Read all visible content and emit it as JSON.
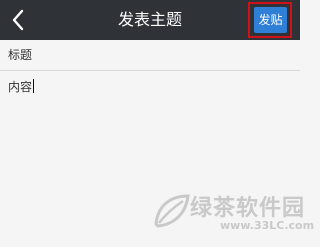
{
  "navbar": {
    "title": "发表主题",
    "back_icon": "chevron-left-icon",
    "post_label": "发贴",
    "colors": {
      "background": "#2f3338",
      "post_button": "#2f7fd7",
      "highlight": "#d0111a"
    }
  },
  "form": {
    "title_placeholder": "标题",
    "title_value": "",
    "content_placeholder": "内容",
    "content_value": ""
  },
  "watermark": {
    "text": "绿茶软件园",
    "url": "www.33LC.com"
  }
}
